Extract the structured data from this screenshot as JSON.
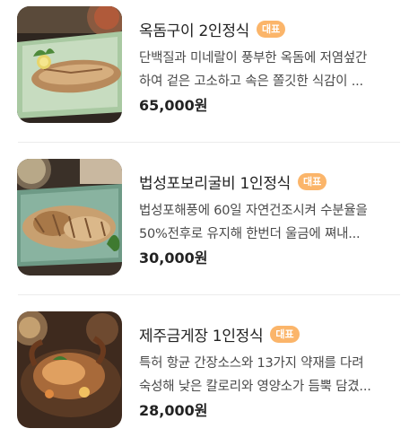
{
  "menu": {
    "items": [
      {
        "title": "옥돔구이 2인정식",
        "badge": "대표",
        "desc_line1": "단백질과 미네랄이 풍부한 옥돔에 저염섶간",
        "desc_line2": "하여 겉은 고소하고 속은 쫄깃한 식감이 ...",
        "price": "65,000원",
        "image": "grilled-tilefish-photo"
      },
      {
        "title": "법성포보리굴비 1인정식",
        "badge": "대표",
        "desc_line1": "법성포해풍에 60일 자연건조시켜 수분율을",
        "desc_line2": "50%전후로 유지해 한번더 울금에 쪄내...",
        "price": "30,000원",
        "image": "dried-yellow-croaker-photo"
      },
      {
        "title": "제주금게장 1인정식",
        "badge": "대표",
        "desc_line1": "특허 항균 간장소스와 13가지 약재를 다려",
        "desc_line2": "숙성해 낮은 칼로리와 영양소가 듬뿍 담겼...",
        "price": "28,000원",
        "image": "soy-marinated-crab-photo"
      }
    ]
  },
  "colors": {
    "badge_bg": "#fbb56a",
    "divider": "#ececec"
  }
}
